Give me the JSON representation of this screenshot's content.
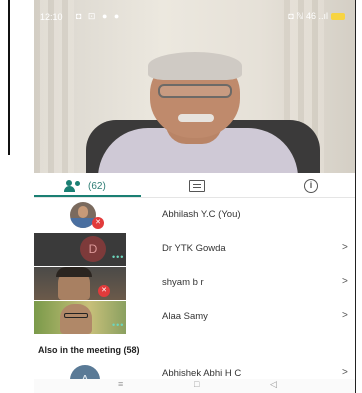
{
  "status_bar": {
    "time": "12:10",
    "notif_icons": "◘ ⊡ ● ●",
    "right_icons": "◘ ℕ 46 ..ıl"
  },
  "tabs": {
    "participants_count": "(62)"
  },
  "participants": [
    {
      "name": "Abhilash Y.C (You)",
      "muted": true
    },
    {
      "name": "Dr YTK Gowda",
      "avatar_letter": "D",
      "muted": false
    },
    {
      "name": "shyam b r",
      "muted": true
    },
    {
      "name": "Alaa Samy",
      "muted": false
    }
  ],
  "also_in_meeting": {
    "label": "Also in the meeting (58)",
    "first_name": "Abhishek Abhi H C",
    "first_avatar_letter": "A"
  },
  "chevron": ">",
  "nav": {
    "menu": "≡",
    "home": "□",
    "back": "◁"
  },
  "colors": {
    "accent": "#1a7f73",
    "mic_off": "#e23b3b"
  }
}
